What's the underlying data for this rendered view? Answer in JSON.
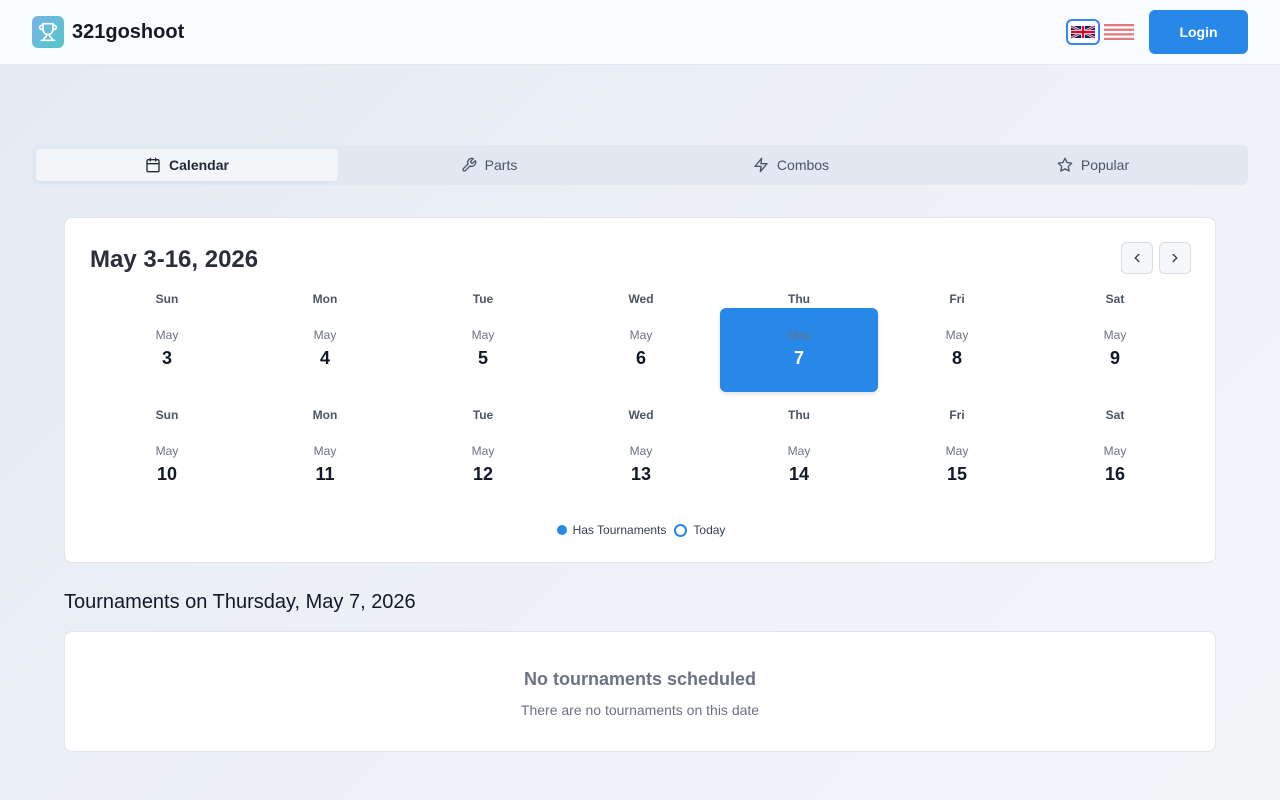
{
  "header": {
    "brand": "321goshoot",
    "login_label": "Login",
    "languages": [
      {
        "code": "en-GB",
        "icon": "uk-flag-icon",
        "selected": true
      },
      {
        "code": "en-US",
        "icon": "us-flag-icon",
        "selected": false
      }
    ]
  },
  "tabs": [
    {
      "label": "Calendar",
      "icon": "calendar-icon",
      "active": true
    },
    {
      "label": "Parts",
      "icon": "wrench-icon",
      "active": false
    },
    {
      "label": "Combos",
      "icon": "lightning-icon",
      "active": false
    },
    {
      "label": "Popular",
      "icon": "star-icon",
      "active": false
    }
  ],
  "calendar": {
    "title": "May 3-16, 2026",
    "weeks": [
      {
        "days": [
          {
            "dow": "Sun",
            "month": "May",
            "day": "3"
          },
          {
            "dow": "Mon",
            "month": "May",
            "day": "4"
          },
          {
            "dow": "Tue",
            "month": "May",
            "day": "5"
          },
          {
            "dow": "Wed",
            "month": "May",
            "day": "6"
          },
          {
            "dow": "Thu",
            "month": "May",
            "day": "7",
            "selected": true
          },
          {
            "dow": "Fri",
            "month": "May",
            "day": "8"
          },
          {
            "dow": "Sat",
            "month": "May",
            "day": "9"
          }
        ]
      },
      {
        "days": [
          {
            "dow": "Sun",
            "month": "May",
            "day": "10"
          },
          {
            "dow": "Mon",
            "month": "May",
            "day": "11"
          },
          {
            "dow": "Tue",
            "month": "May",
            "day": "12"
          },
          {
            "dow": "Wed",
            "month": "May",
            "day": "13"
          },
          {
            "dow": "Thu",
            "month": "May",
            "day": "14"
          },
          {
            "dow": "Fri",
            "month": "May",
            "day": "15"
          },
          {
            "dow": "Sat",
            "month": "May",
            "day": "16"
          }
        ]
      }
    ],
    "legend": {
      "has_tournaments": "Has Tournaments",
      "today": "Today"
    }
  },
  "tournaments": {
    "title": "Tournaments on Thursday, May 7, 2026",
    "empty_title": "No tournaments scheduled",
    "empty_subtitle": "There are no tournaments on this date"
  },
  "colors": {
    "accent": "#2788e8",
    "background": "#eaeff6"
  }
}
